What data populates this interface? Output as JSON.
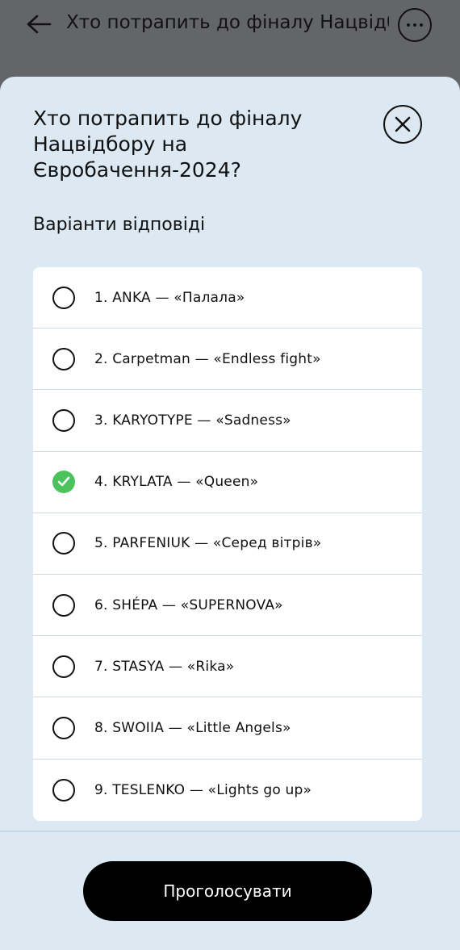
{
  "header": {
    "title": "Хто потрапить до фіналу Нацвідбору на Євр...",
    "back_icon": "arrow-left-icon",
    "more_icon": "more-horizontal-icon"
  },
  "sheet": {
    "title": "Хто потрапить до фіналу Нацвідбору на Євробачення-2024?",
    "close_icon": "close-icon",
    "subtitle": "Варіанти відповіді",
    "options": [
      {
        "label": "1. ANKA — «Палала»",
        "selected": false
      },
      {
        "label": "2. Carpetman — «Endless fight»",
        "selected": false
      },
      {
        "label": "3. KARYOTYPE — «Sadness»",
        "selected": false
      },
      {
        "label": "4. KRYLATA — «Queen»",
        "selected": true
      },
      {
        "label": "5. PARFENIUK — «Серед вітрів»",
        "selected": false
      },
      {
        "label": "6. SHÉPA — «SUPERNOVA»",
        "selected": false
      },
      {
        "label": "7. STASYA — «Rika»",
        "selected": false
      },
      {
        "label": "8. SWOIIA — «Little Angels»",
        "selected": false
      },
      {
        "label": "9. TESLENKO — «Lights go up»",
        "selected": false
      }
    ],
    "vote_label": "Проголосувати"
  },
  "colors": {
    "overlay": "#636569",
    "sheet_bg": "#dce9f3",
    "check_green": "#4cc25c",
    "button_bg": "#000000"
  }
}
